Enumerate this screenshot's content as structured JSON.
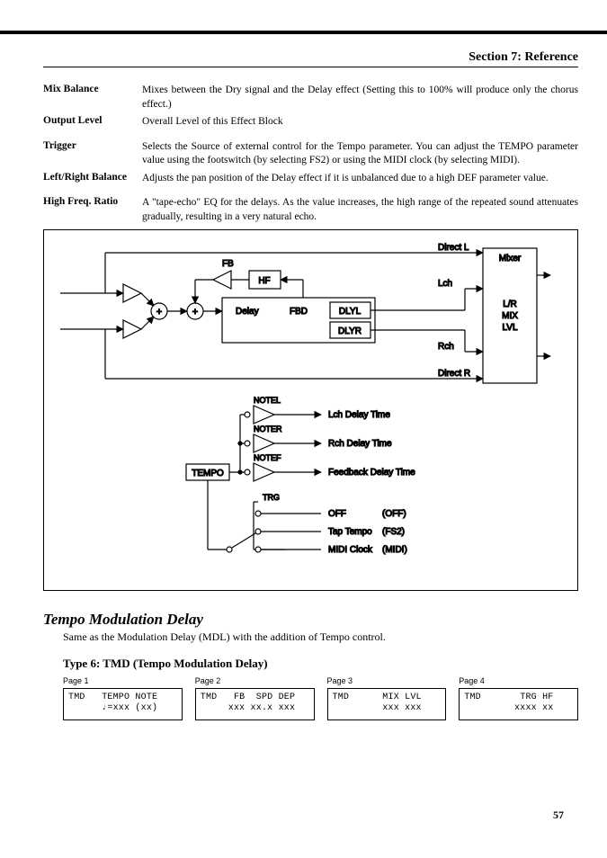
{
  "header": {
    "section": "Section 7: Reference"
  },
  "params": [
    {
      "label": "Mix Balance",
      "desc": "Mixes between the Dry signal and the Delay effect (Setting this to 100% will produce only the chorus effect.)"
    },
    {
      "label": "Output Level",
      "desc": "Overall Level of this Effect Block"
    },
    {
      "label": "",
      "desc": ""
    },
    {
      "label": "Trigger",
      "desc": "Selects the Source of external control for the Tempo parameter. You can adjust the TEMPO parameter value using the footswitch (by selecting FS2) or using the MIDI clock (by selecting MIDI)."
    },
    {
      "label": "Left/Right Balance",
      "desc": "Adjusts the pan position of the Delay effect if it is unbalanced due to a high DEF parameter value."
    },
    {
      "label": "",
      "desc": ""
    },
    {
      "label": "High Freq. Ratio",
      "desc": "A \"tape-echo\" EQ for the delays. As the value increases, the high range of the repeated sound attenuates gradually, resulting in a very natural echo."
    }
  ],
  "diagram": {
    "labels": {
      "directL": "Direct L",
      "directR": "Direct R",
      "mixer": "Mixer",
      "lch": "Lch",
      "rch": "Rch",
      "fb": "FB",
      "hf": "HF",
      "delay": "Delay",
      "fbd": "FBD",
      "dlyl": "DLYL",
      "dlyr": "DLYR",
      "lr": "L/R",
      "mix": "MIX",
      "lvl": "LVL",
      "notel": "NOTEL",
      "noter": "NOTER",
      "notef": "NOTEF",
      "tempo": "TEMPO",
      "trg": "TRG",
      "lchdt": "Lch Delay Time",
      "rchdt": "Rch Delay Time",
      "fbdt": "Feedback Delay Time",
      "off": "OFF",
      "offp": "(OFF)",
      "tap": "Tap Tempo",
      "fs2": "(FS2)",
      "midi": "MIDI Clock",
      "midip": "(MIDI)"
    }
  },
  "tmd": {
    "title": "Tempo Modulation Delay",
    "desc": "Same as the Modulation Delay (MDL) with the addition of Tempo control.",
    "typeTitle": "Type 6: TMD (Tempo Modulation Delay)",
    "pages": [
      {
        "label": "Page 1",
        "line1": "TMD   TEMPO NOTE",
        "line2": "      ♩=xxx (xx)"
      },
      {
        "label": "Page 2",
        "line1": "TMD   FB  SPD DEP",
        "line2": "     xxx xx.x xxx"
      },
      {
        "label": "Page 3",
        "line1": "TMD      MIX LVL",
        "line2": "         xxx xxx"
      },
      {
        "label": "Page 4",
        "line1": "TMD       TRG HF",
        "line2": "         xxxx xx"
      }
    ]
  },
  "pageNumber": "57"
}
